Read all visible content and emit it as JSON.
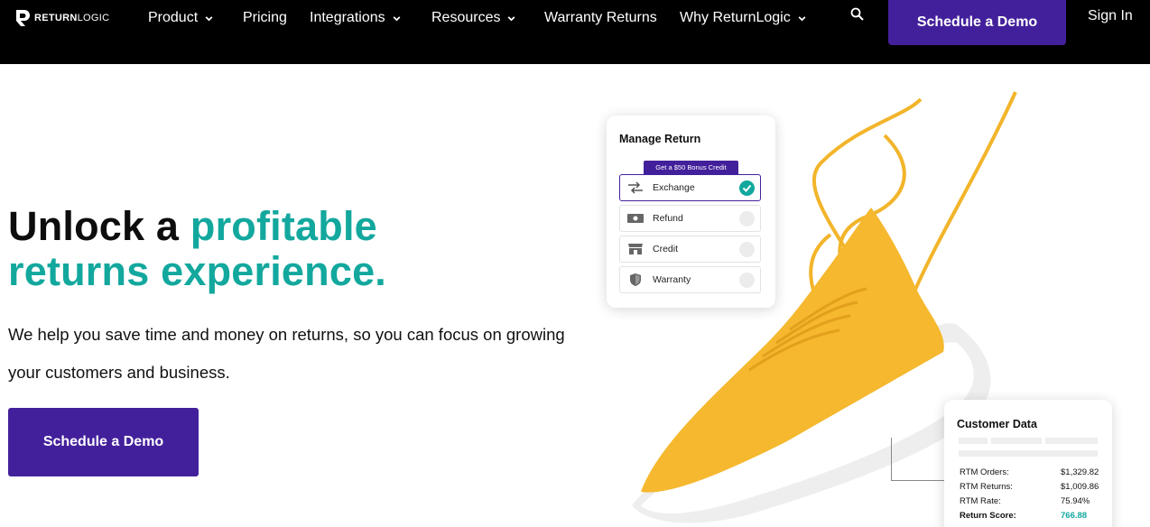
{
  "nav": {
    "logo": {
      "bold": "RETURN",
      "light": "LOGIC",
      "icon": "returnlogic-logo-icon"
    },
    "items": [
      {
        "label": "Product",
        "dropdown": true
      },
      {
        "label": "Pricing",
        "dropdown": false
      },
      {
        "label": "Integrations",
        "dropdown": true
      },
      {
        "label": "Resources",
        "dropdown": true
      },
      {
        "label": "Warranty Returns",
        "dropdown": false
      },
      {
        "label": "Why ReturnLogic",
        "dropdown": true
      }
    ],
    "search_icon": "search-icon",
    "cta_label": "Schedule a Demo",
    "signin_label": "Sign In"
  },
  "hero": {
    "title_part1": "Unlock a ",
    "title_highlight_line1": "profitable",
    "title_highlight_line2": "returns experience.",
    "subtitle": "We help you save time and money on returns, so you can focus on growing your customers and business.",
    "cta_label": "Schedule a Demo"
  },
  "manage_return": {
    "title": "Manage Return",
    "bonus": "Get a $50 Bonus Credit",
    "options": [
      {
        "label": "Exchange",
        "icon": "exchange-arrows-icon",
        "selected": true
      },
      {
        "label": "Refund",
        "icon": "cash-icon",
        "selected": false
      },
      {
        "label": "Credit",
        "icon": "store-icon",
        "selected": false
      },
      {
        "label": "Warranty",
        "icon": "shield-icon",
        "selected": false
      }
    ]
  },
  "customer_data": {
    "title": "Customer Data",
    "rows": [
      {
        "label": "RTM Orders:",
        "value": "$1,329.82"
      },
      {
        "label": "RTM Returns:",
        "value": "$1,009.86"
      },
      {
        "label": "RTM Rate:",
        "value": "75.94%"
      },
      {
        "label": "Return Score:",
        "value": "766.88"
      }
    ]
  },
  "colors": {
    "nav_bg": "#000000",
    "brand_purple": "#43209b",
    "teal": "#13a89e",
    "shoe_yellow": "#f5b82e"
  }
}
